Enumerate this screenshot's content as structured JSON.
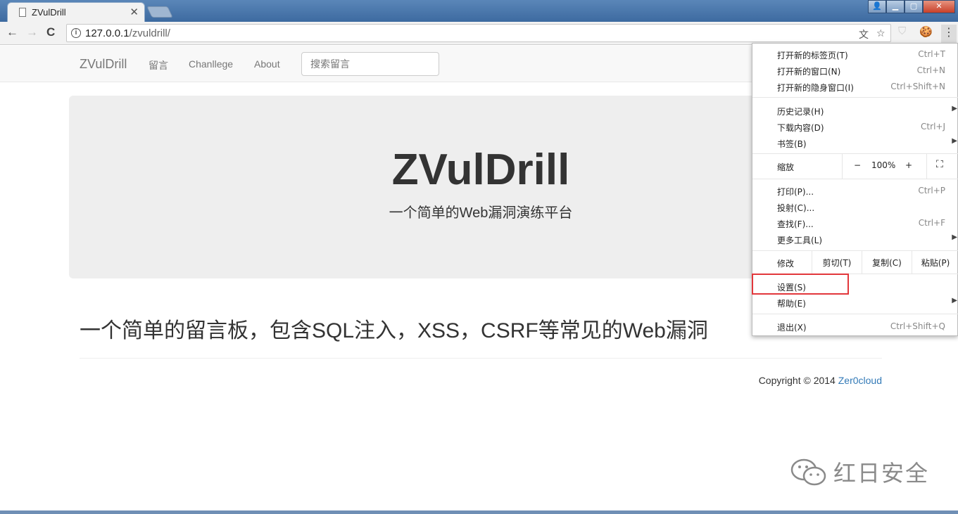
{
  "browser": {
    "tab_title": "ZVulDrill",
    "tab_close": "✕",
    "window_title": "",
    "url_host": "127.0.0.1",
    "url_path": "/zvuldrill/",
    "back": "←",
    "forward": "→",
    "reload": "C",
    "info": "i",
    "translate": "文",
    "bookmark_star": "☆",
    "ext1": "⛉",
    "ext2": "🍪",
    "menu_dots": "⋮",
    "win_min": "▁",
    "win_max": "▢",
    "win_close": "✕"
  },
  "navbar": {
    "brand": "ZVulDrill",
    "links": [
      "留言",
      "Chanllege",
      "About"
    ],
    "search_placeholder": "搜索留言"
  },
  "jumbotron": {
    "title": "ZVulDrill",
    "subtitle": "一个简单的Web漏洞演练平台"
  },
  "content": {
    "headline": "一个简单的留言板，包含SQL注入，XSS，CSRF等常见的Web漏洞",
    "copyright_prefix": "Copyright © 2014 ",
    "copyright_link": "Zer0cloud"
  },
  "menu": {
    "group1": [
      {
        "label": "打开新的标签页(T)",
        "shortcut": "Ctrl+T"
      },
      {
        "label": "打开新的窗口(N)",
        "shortcut": "Ctrl+N"
      },
      {
        "label": "打开新的隐身窗口(I)",
        "shortcut": "Ctrl+Shift+N"
      }
    ],
    "group2": [
      {
        "label": "历史记录(H)",
        "shortcut": ""
      },
      {
        "label": "下载内容(D)",
        "shortcut": "Ctrl+J"
      },
      {
        "label": "书签(B)",
        "shortcut": ""
      }
    ],
    "zoom": {
      "label": "缩放",
      "minus": "−",
      "value": "100%",
      "plus": "+",
      "fullscreen": "⛶"
    },
    "group3": [
      {
        "label": "打印(P)...",
        "shortcut": "Ctrl+P"
      },
      {
        "label": "投射(C)...",
        "shortcut": ""
      },
      {
        "label": "查找(F)...",
        "shortcut": "Ctrl+F"
      },
      {
        "label": "更多工具(L)",
        "shortcut": ""
      }
    ],
    "edit": {
      "label": "修改",
      "cut": "剪切(T)",
      "copy": "复制(C)",
      "paste": "粘贴(P)"
    },
    "settings": "设置(S)",
    "help": "帮助(E)",
    "exit": {
      "label": "退出(X)",
      "shortcut": "Ctrl+Shift+Q"
    },
    "submenu_arrow": "▶"
  },
  "watermark": {
    "text": "红日安全"
  },
  "colors": {
    "highlight": "#e2373b",
    "link": "#337ab7"
  }
}
